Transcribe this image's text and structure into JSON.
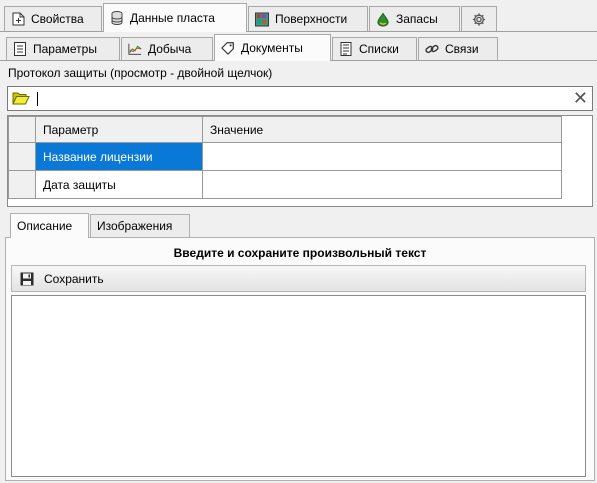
{
  "top_tabs": [
    {
      "label": "Свойства",
      "icon": "document-plus-icon",
      "active": false
    },
    {
      "label": "Данные пласта",
      "icon": "database-icon",
      "active": true
    },
    {
      "label": "Поверхности",
      "icon": "surface-grid-icon",
      "active": false
    },
    {
      "label": "Запасы",
      "icon": "reserves-drop-icon",
      "active": false
    },
    {
      "label": "",
      "icon": "gear-icon",
      "active": false
    }
  ],
  "sub_tabs": [
    {
      "label": "Параметры",
      "icon": "list-document-icon",
      "active": false
    },
    {
      "label": "Добыча",
      "icon": "line-chart-icon",
      "active": false
    },
    {
      "label": "Документы",
      "icon": "tag-icon",
      "active": true
    },
    {
      "label": "Списки",
      "icon": "list-icon",
      "active": false
    },
    {
      "label": "Связи",
      "icon": "link-icon",
      "active": false
    }
  ],
  "documents": {
    "caption": "Протокол защиты (просмотр - двойной щелчок)",
    "path_value": "",
    "clear_glyph": "✕"
  },
  "grid": {
    "columns": [
      "Параметр",
      "Значение"
    ],
    "rows": [
      {
        "param": "Название лицензии",
        "value": "",
        "selected": true
      },
      {
        "param": "Дата защиты",
        "value": "",
        "selected": false
      }
    ]
  },
  "bottom_tabs": [
    {
      "label": "Описание",
      "active": true
    },
    {
      "label": "Изображения",
      "active": false
    }
  ],
  "description": {
    "heading": "Введите и сохраните произвольный текст",
    "save_label": "Сохранить",
    "text": ""
  },
  "colors": {
    "selection": "#0a78d7",
    "chart_icon": "#2a9d2a",
    "drop_icon": "#2e8b2e"
  }
}
